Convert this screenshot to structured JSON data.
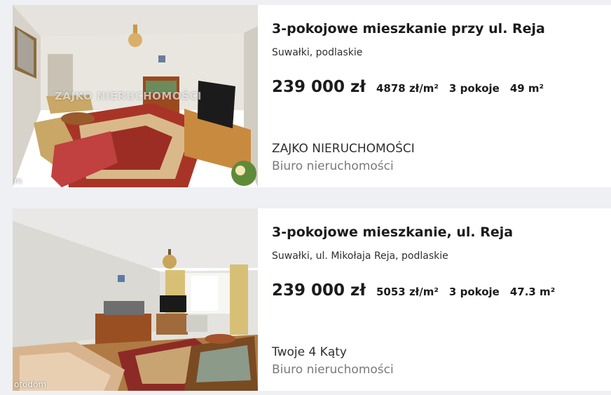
{
  "listings": [
    {
      "title": "3-pokojowe mieszkanie przy ul. Reja",
      "location": "Suwałki, podlaskie",
      "price": "239 000 zł",
      "price_per_m2": "4878 zł/m²",
      "rooms": "3 pokoje",
      "area": "49 m²",
      "agency_name": "ZAJKO NIERUCHOMOŚCI",
      "agency_type": "Biuro nieruchomości",
      "photo_watermark": "ZAJKO NIERUCHOMOŚCI",
      "photo_brand": "m"
    },
    {
      "title": "3-pokojowe mieszkanie, ul. Reja",
      "location": "Suwałki, ul. Mikołaja Reja, podlaskie",
      "price": "239 000 zł",
      "price_per_m2": "5053 zł/m²",
      "rooms": "3 pokoje",
      "area": "47.3 m²",
      "agency_name": "Twoje 4 Kąty",
      "agency_type": "Biuro nieruchomości",
      "photo_brand": "otodom"
    }
  ]
}
